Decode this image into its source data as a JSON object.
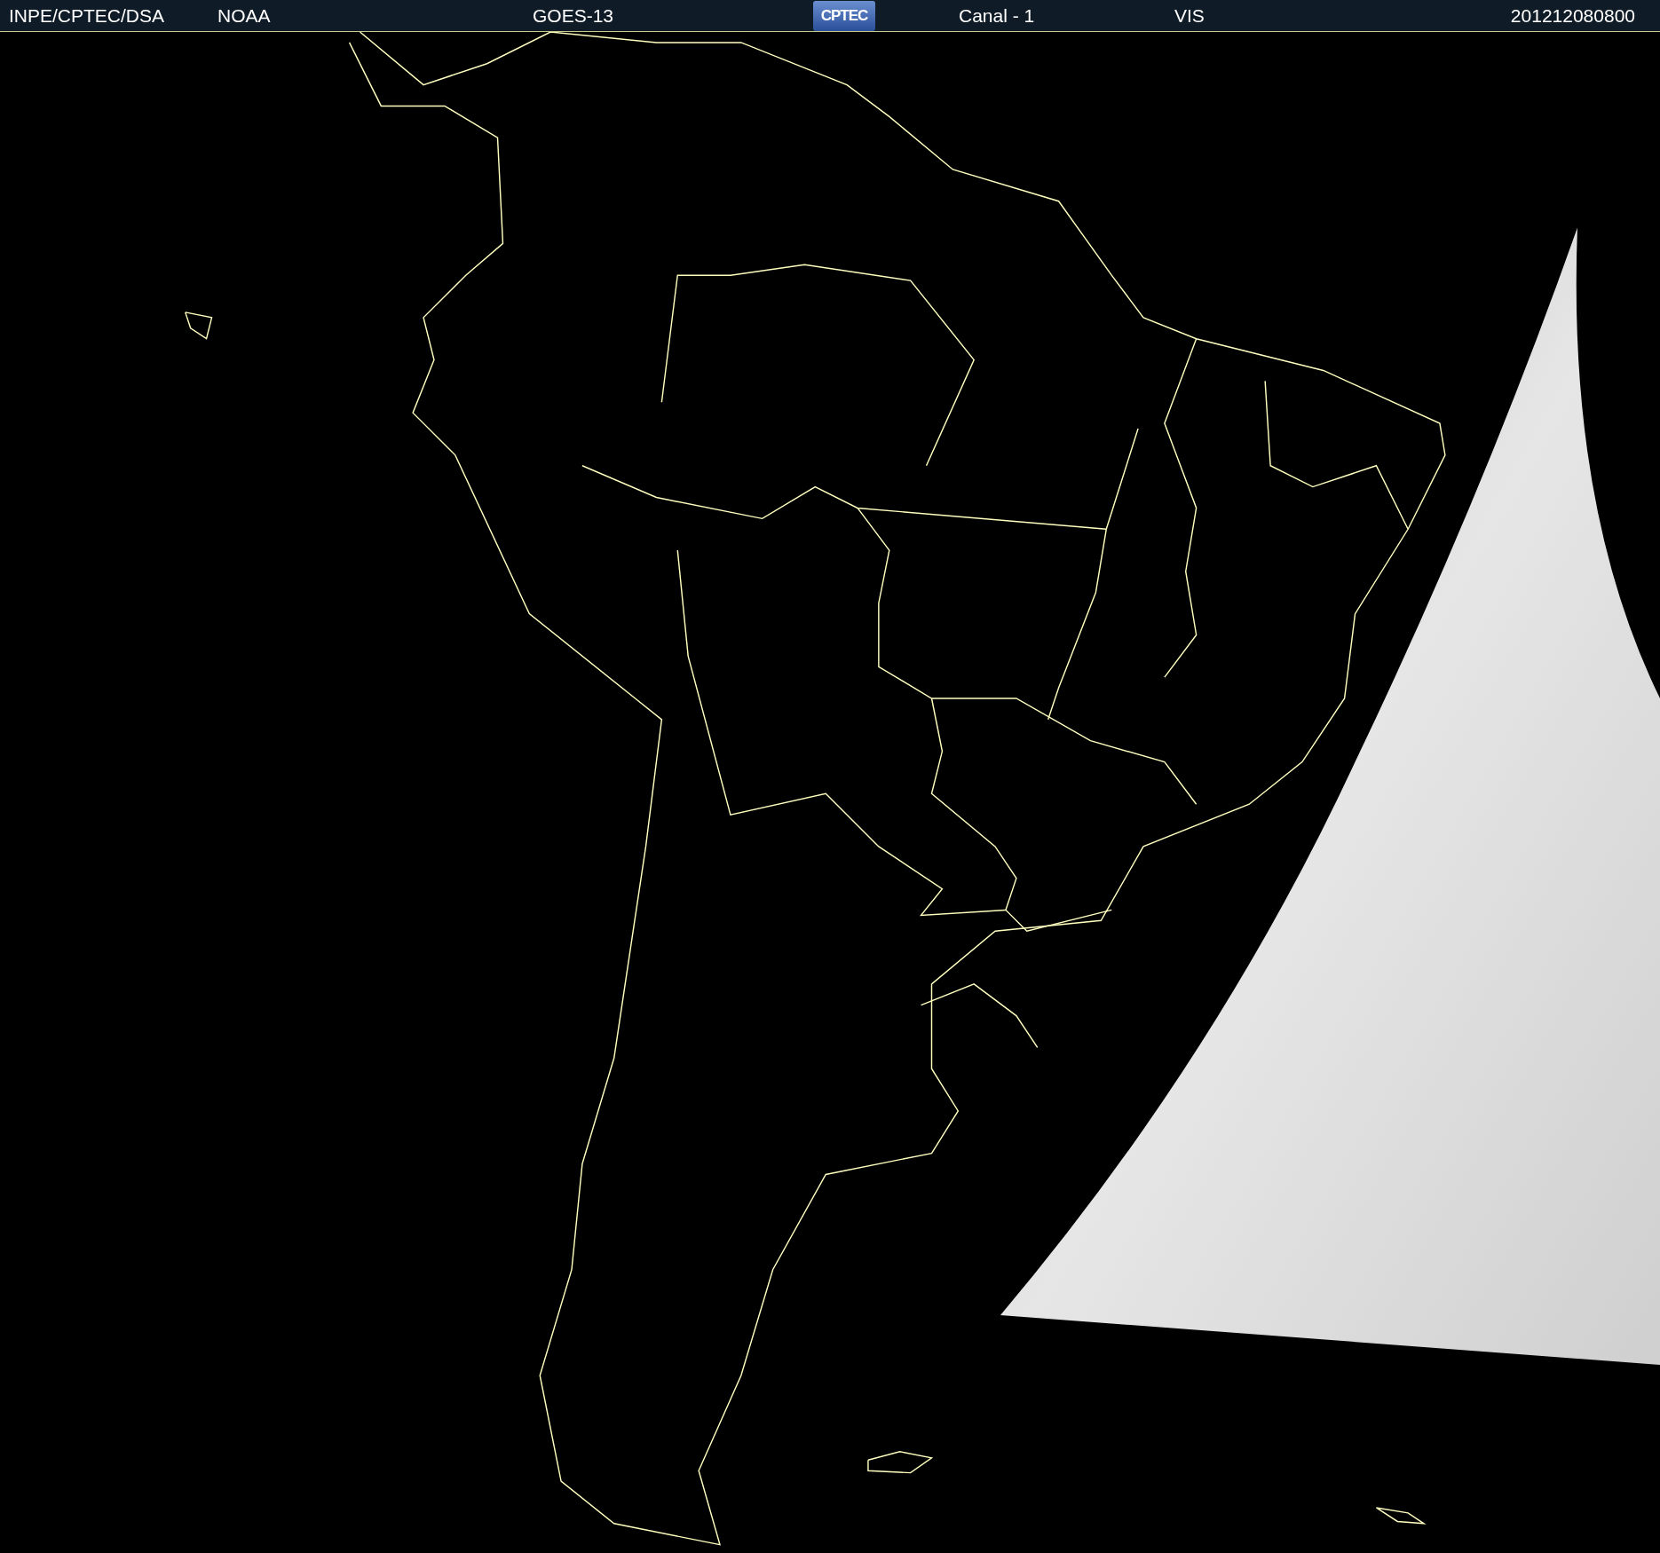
{
  "header": {
    "items": [
      {
        "kind": "text",
        "text": "INPE/CPTEC/DSA"
      },
      {
        "kind": "text",
        "text": "NOAA"
      },
      {
        "kind": "text",
        "text": "GOES-13"
      },
      {
        "kind": "logo",
        "text": "CPTEC"
      },
      {
        "kind": "text",
        "text": "Canal - 1"
      },
      {
        "kind": "text",
        "text": "VIS"
      },
      {
        "kind": "text",
        "text": "201212080800"
      }
    ]
  }
}
